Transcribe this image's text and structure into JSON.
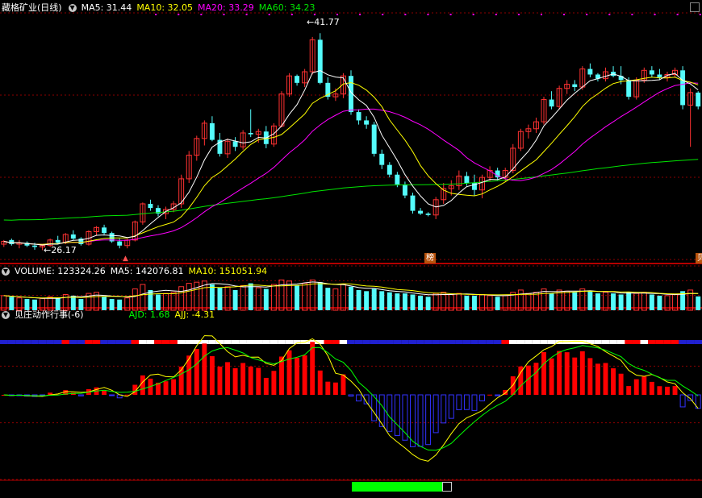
{
  "price_header": {
    "stock": "藏格矿业(日线)",
    "ma5": "MA5: 31.44",
    "ma10": "MA10: 32.05",
    "ma20": "MA20: 33.29",
    "ma60": "MA60: 34.23"
  },
  "volume_header": {
    "volume": "VOLUME: 123324.26",
    "ma5": "MA5: 142076.81",
    "ma10": "MA10: 151051.94"
  },
  "indicator_header": {
    "name": "见庄动作行事(-6)",
    "ajd": "AJD: 1.68",
    "ajj": "AJJ: -4.31"
  },
  "annotations": {
    "high": "41.77",
    "low": "26.17",
    "bang_label": "榜",
    "edge_label": "贝"
  },
  "colors": {
    "up": "#ff3232",
    "down": "#54fcfc",
    "ma5": "#ffffff",
    "ma10": "#ffff00",
    "ma20": "#ff00ff",
    "ma60": "#00e600",
    "grid": "#8b0000",
    "bar_red": "#ff0000",
    "bar_blue": "#3232ff"
  },
  "chart_data": [
    {
      "type": "candlestick",
      "price_range": [
        25.5,
        43.0
      ],
      "high_mark": 41.77,
      "low_mark": 26.17,
      "ohlc": [
        [
          26.6,
          26.9,
          26.4,
          26.8
        ],
        [
          26.9,
          27.0,
          26.5,
          26.6
        ],
        [
          26.6,
          26.9,
          26.3,
          26.7
        ],
        [
          26.7,
          26.8,
          26.4,
          26.5
        ],
        [
          26.5,
          26.7,
          26.2,
          26.4
        ],
        [
          26.4,
          26.6,
          26.17,
          26.5
        ],
        [
          26.5,
          27.0,
          26.4,
          26.9
        ],
        [
          26.9,
          27.2,
          26.6,
          26.7
        ],
        [
          26.7,
          27.4,
          26.6,
          27.3
        ],
        [
          27.3,
          27.6,
          26.9,
          27.0
        ],
        [
          27.0,
          27.1,
          26.5,
          26.6
        ],
        [
          26.6,
          27.6,
          26.5,
          27.5
        ],
        [
          27.5,
          27.9,
          27.2,
          27.8
        ],
        [
          27.8,
          28.0,
          27.3,
          27.4
        ],
        [
          27.4,
          27.5,
          26.7,
          26.8
        ],
        [
          26.8,
          27.0,
          26.3,
          26.5
        ],
        [
          26.5,
          27.0,
          26.3,
          26.9
        ],
        [
          26.9,
          28.3,
          26.8,
          28.2
        ],
        [
          28.2,
          29.6,
          28.0,
          29.5
        ],
        [
          29.5,
          29.8,
          29.0,
          29.2
        ],
        [
          29.2,
          29.4,
          28.6,
          28.8
        ],
        [
          28.8,
          29.3,
          28.4,
          29.1
        ],
        [
          29.1,
          29.7,
          28.9,
          29.5
        ],
        [
          29.5,
          31.6,
          29.2,
          31.3
        ],
        [
          31.3,
          33.3,
          31.0,
          33.0
        ],
        [
          33.0,
          34.4,
          32.6,
          34.2
        ],
        [
          34.2,
          35.5,
          33.7,
          35.3
        ],
        [
          35.3,
          35.8,
          34.0,
          34.1
        ],
        [
          34.1,
          34.6,
          32.9,
          33.1
        ],
        [
          33.1,
          34.2,
          32.8,
          34.0
        ],
        [
          34.0,
          34.3,
          33.3,
          33.6
        ],
        [
          33.6,
          34.8,
          33.4,
          34.6
        ],
        [
          34.6,
          36.3,
          34.3,
          34.5
        ],
        [
          34.5,
          34.9,
          33.9,
          34.7
        ],
        [
          34.7,
          35.1,
          33.5,
          33.8
        ],
        [
          33.8,
          35.3,
          33.6,
          35.1
        ],
        [
          35.1,
          37.6,
          35.0,
          37.4
        ],
        [
          37.4,
          38.9,
          37.2,
          38.7
        ],
        [
          38.7,
          38.8,
          38.0,
          38.2
        ],
        [
          38.2,
          39.2,
          37.9,
          39.0
        ],
        [
          39.0,
          41.5,
          38.8,
          41.3
        ],
        [
          41.3,
          41.77,
          38.1,
          38.2
        ],
        [
          38.2,
          38.6,
          37.0,
          37.2
        ],
        [
          37.2,
          37.8,
          36.9,
          37.4
        ],
        [
          37.4,
          38.9,
          37.1,
          38.7
        ],
        [
          38.7,
          39.1,
          35.9,
          36.1
        ],
        [
          36.1,
          36.3,
          35.2,
          35.5
        ],
        [
          35.5,
          35.8,
          34.9,
          35.2
        ],
        [
          35.2,
          35.4,
          32.9,
          33.1
        ],
        [
          33.1,
          33.4,
          32.0,
          32.3
        ],
        [
          32.3,
          32.5,
          31.4,
          31.6
        ],
        [
          31.6,
          31.8,
          30.7,
          30.9
        ],
        [
          30.9,
          31.1,
          29.9,
          30.1
        ],
        [
          30.1,
          30.3,
          28.8,
          29.0
        ],
        [
          29.0,
          29.2,
          28.7,
          28.8
        ],
        [
          28.8,
          28.9,
          28.6,
          28.7
        ],
        [
          28.7,
          30.0,
          28.4,
          29.8
        ],
        [
          29.8,
          31.0,
          29.5,
          30.6
        ],
        [
          30.6,
          31.2,
          30.1,
          30.8
        ],
        [
          30.8,
          31.9,
          30.5,
          31.5
        ],
        [
          31.5,
          31.8,
          30.8,
          31.0
        ],
        [
          31.0,
          31.6,
          30.1,
          30.5
        ],
        [
          30.5,
          31.6,
          29.9,
          31.4
        ],
        [
          31.4,
          32.2,
          31.1,
          31.9
        ],
        [
          31.9,
          32.1,
          31.2,
          31.4
        ],
        [
          31.4,
          32.1,
          31.1,
          31.9
        ],
        [
          31.9,
          33.8,
          31.7,
          33.5
        ],
        [
          33.5,
          34.9,
          33.3,
          34.7
        ],
        [
          34.7,
          35.2,
          34.2,
          34.9
        ],
        [
          34.9,
          35.7,
          34.6,
          35.4
        ],
        [
          35.4,
          37.2,
          35.2,
          37.0
        ],
        [
          37.0,
          37.6,
          36.3,
          36.5
        ],
        [
          36.5,
          38.0,
          36.3,
          37.8
        ],
        [
          37.8,
          38.4,
          37.4,
          38.1
        ],
        [
          38.1,
          38.4,
          37.6,
          37.9
        ],
        [
          37.9,
          39.4,
          37.7,
          39.2
        ],
        [
          39.2,
          39.6,
          38.6,
          38.8
        ],
        [
          38.8,
          38.9,
          38.3,
          38.5
        ],
        [
          38.5,
          39.3,
          38.3,
          39.0
        ],
        [
          39.0,
          39.4,
          38.6,
          38.7
        ],
        [
          38.7,
          39.4,
          38.1,
          38.4
        ],
        [
          38.4,
          38.6,
          37.0,
          37.2
        ],
        [
          37.2,
          38.6,
          37.0,
          38.4
        ],
        [
          38.4,
          39.3,
          38.2,
          39.1
        ],
        [
          39.1,
          39.4,
          38.6,
          38.8
        ],
        [
          38.8,
          39.2,
          38.4,
          38.6
        ],
        [
          38.6,
          39.0,
          38.3,
          38.8
        ],
        [
          38.8,
          39.3,
          38.6,
          39.1
        ],
        [
          39.1,
          39.4,
          36.3,
          36.6
        ],
        [
          36.6,
          37.8,
          33.6,
          37.5
        ],
        [
          37.5,
          37.6,
          36.3,
          36.5
        ]
      ]
    },
    {
      "type": "bar",
      "ylim": [
        0,
        280000
      ],
      "values": [
        130000,
        120000,
        110000,
        100000,
        95000,
        105000,
        120000,
        110000,
        140000,
        130000,
        100000,
        150000,
        160000,
        120000,
        100000,
        95000,
        110000,
        190000,
        230000,
        180000,
        140000,
        150000,
        160000,
        210000,
        240000,
        250000,
        260000,
        230000,
        200000,
        210000,
        180000,
        220000,
        240000,
        200000,
        190000,
        230000,
        270000,
        260000,
        220000,
        240000,
        270000,
        250000,
        200000,
        190000,
        230000,
        210000,
        180000,
        170000,
        190000,
        170000,
        160000,
        150000,
        150000,
        140000,
        130000,
        120000,
        150000,
        160000,
        140000,
        150000,
        130000,
        130000,
        140000,
        130000,
        120000,
        130000,
        160000,
        180000,
        150000,
        160000,
        190000,
        150000,
        180000,
        170000,
        160000,
        190000,
        170000,
        150000,
        160000,
        150000,
        140000,
        160000,
        150000,
        160000,
        140000,
        130000,
        130000,
        140000,
        170000,
        180000,
        123324
      ]
    },
    {
      "type": "area",
      "ajd": 1.68,
      "ajj": -4.31
    }
  ]
}
